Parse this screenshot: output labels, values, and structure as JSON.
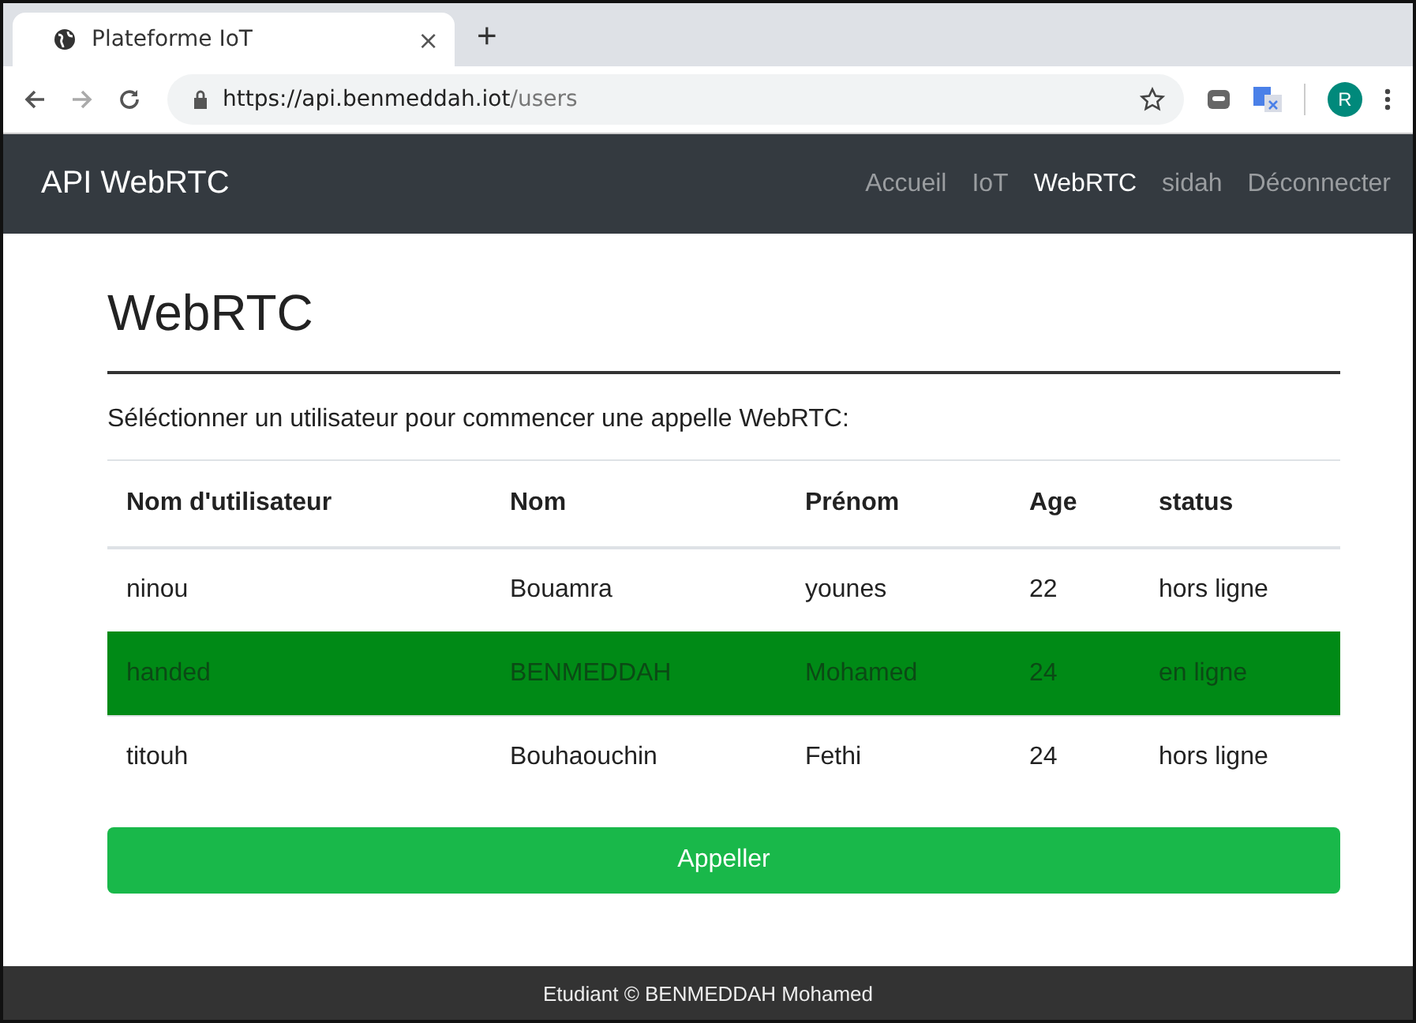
{
  "browser": {
    "tab_title": "Plateforme IoT",
    "close": "×",
    "new_tab": "+",
    "url_host": "https://api.benmeddah.iot",
    "url_path": "/users",
    "avatar": "R"
  },
  "navbar": {
    "brand": "API WebRTC",
    "links": [
      {
        "label": "Accueil",
        "selected": false
      },
      {
        "label": "IoT",
        "selected": false
      },
      {
        "label": "WebRTC",
        "selected": true
      },
      {
        "label": "sidah",
        "selected": false
      },
      {
        "label": "Déconnecter",
        "selected": false
      }
    ]
  },
  "page": {
    "heading": "WebRTC",
    "intro": "Séléctionner un utilisateur pour commencer une appelle WebRTC:"
  },
  "table": {
    "columns": [
      "Nom d'utilisateur",
      "Nom",
      "Prénom",
      "Age",
      "status"
    ],
    "rows": [
      {
        "cells": [
          "ninou",
          "Bouamra",
          "younes",
          "22",
          "hors ligne"
        ],
        "selected": false
      },
      {
        "cells": [
          "handed",
          "BENMEDDAH",
          "Mohamed",
          "24",
          "en ligne"
        ],
        "selected": true
      },
      {
        "cells": [
          "titouh",
          "Bouhaouchin",
          "Fethi",
          "24",
          "hors ligne"
        ],
        "selected": false
      }
    ]
  },
  "call_button": "Appeller",
  "footer": "Etudiant © BENMEDDAH Mohamed"
}
